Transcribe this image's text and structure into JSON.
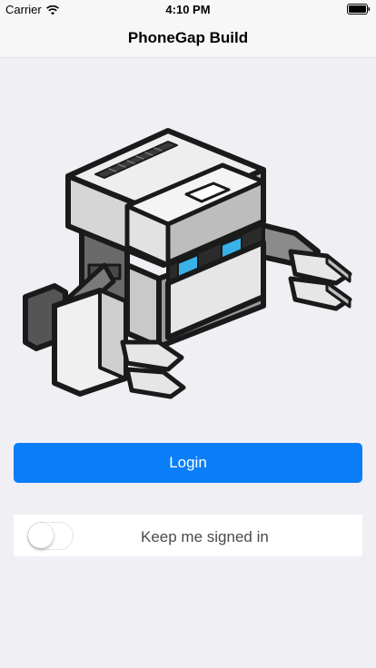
{
  "status_bar": {
    "carrier": "Carrier",
    "time": "4:10 PM"
  },
  "nav": {
    "title": "PhoneGap Build"
  },
  "login_button": {
    "label": "Login",
    "color": "#0a7df8"
  },
  "keep_signed_in": {
    "label": "Keep me signed in",
    "enabled": false
  },
  "icons": [
    "wifi-icon",
    "battery-icon",
    "phonegap-robot-mascot"
  ],
  "colors": {
    "background": "#efeff4",
    "bar": "#f7f7f7",
    "accent": "#0a7df8",
    "eyes": "#39b2e8"
  }
}
